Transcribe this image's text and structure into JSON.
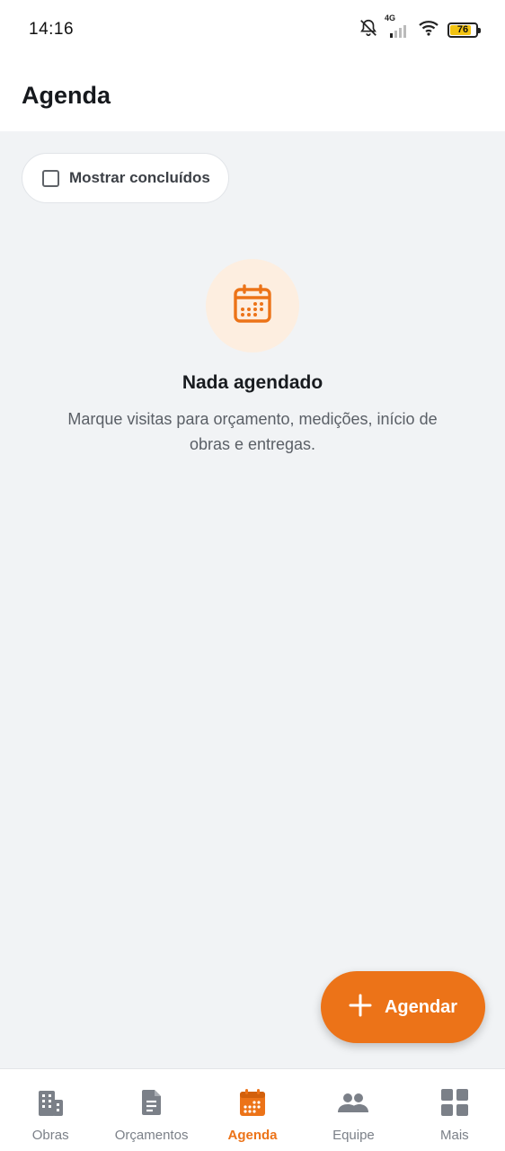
{
  "status_bar": {
    "time": "14:16",
    "network": "4G",
    "battery_level": "76"
  },
  "header": {
    "title": "Agenda"
  },
  "filter": {
    "show_completed_label": "Mostrar concluídos",
    "checked": false
  },
  "empty_state": {
    "icon": "calendar-icon",
    "title": "Nada agendado",
    "description": "Marque visitas para orçamento, medições, início de obras e entregas."
  },
  "fab": {
    "icon": "plus-icon",
    "label": "Agendar"
  },
  "bottom_nav": {
    "items": [
      {
        "label": "Obras",
        "icon": "building-icon",
        "active": false
      },
      {
        "label": "Orçamentos",
        "icon": "document-icon",
        "active": false
      },
      {
        "label": "Agenda",
        "icon": "calendar-icon",
        "active": true
      },
      {
        "label": "Equipe",
        "icon": "people-icon",
        "active": false
      },
      {
        "label": "Mais",
        "icon": "grid-icon",
        "active": false
      }
    ]
  },
  "colors": {
    "accent": "#ec7318",
    "accent_soft": "#fdeee0",
    "background": "#f1f3f5",
    "inactive": "#7b8088"
  }
}
